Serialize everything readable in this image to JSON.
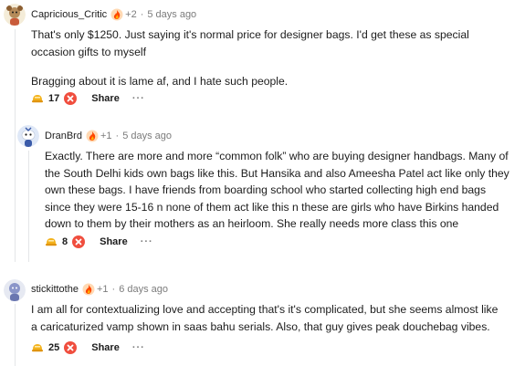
{
  "comments": [
    {
      "username": "Capricious_Critic",
      "more_awards": "+2",
      "time": "5 days ago",
      "paragraphs": [
        "That's only $1250. Just saying it's normal price for designer bags. I'd get these as special occasion gifts to myself",
        "Bragging about it is lame af, and I hate such people."
      ],
      "score": "17",
      "share_label": "Share",
      "more_label": "···"
    },
    {
      "username": "DranBrd",
      "more_awards": "+1",
      "time": "5 days ago",
      "paragraphs": [
        "Exactly. There are more and more “common folk” who are buying designer handbags. Many of the South Delhi kids own bags like this. But Hansika and also Ameesha Patel act like only they own these bags. I have friends from boarding school who started collecting high end bags since they were 15-16 n none of them act like this n these are girls who have Birkins handed down to them by their mothers as an heirloom. She really needs more class this one"
      ],
      "score": "8",
      "share_label": "Share",
      "more_label": "···"
    },
    {
      "username": "stickittothe",
      "more_awards": "+1",
      "time": "6 days ago",
      "paragraphs": [
        "I am all for contextualizing love and accepting that's it's complicated, but she seems almost like a caricaturized vamp shown in saas bahu serials. Also, that guy gives peak douchebag vibes."
      ],
      "score": "25",
      "share_label": "Share",
      "more_label": "···"
    }
  ],
  "icons": {
    "avatar_1": "snoo-avatar-icon",
    "avatar_2": "snoo-avatar-icon",
    "avatar_3": "snoo-avatar-icon",
    "flair": "fire-award-icon",
    "award": "helpful-award-icon",
    "downvote": "downvote-icon"
  },
  "colors": {
    "downvote": "#f04e3e",
    "award_gold": "#f3b21c",
    "meta_gray": "#7c7c7c",
    "thread_line": "#e4e6e8"
  }
}
